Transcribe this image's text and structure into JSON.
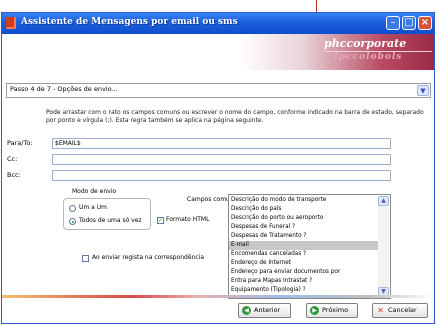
{
  "window": {
    "title": "Assistente de Mensagens por email ou sms",
    "brand_main": "phccorporate",
    "brand_sub": "fpccolobols"
  },
  "step": {
    "selected": "Passo 4 de 7 - Opções de envio..."
  },
  "info_text": "Pode arrastar com o rato os campos comuns ou escrever o nome do campo, conforme indicado na barra de estado, separado por ponto e vírgula (;). Esta regra também se aplica na página seguinte.",
  "fields": {
    "para_label": "Para/To:",
    "para_value": "$EMAIL$",
    "cc_label": "Cc:",
    "cc_value": "",
    "bcc_label": "Bcc:",
    "bcc_value": ""
  },
  "send_mode": {
    "label": "Modo de envio",
    "option_one": "Um a Um",
    "option_all": "Todos de uma só vez",
    "selected": "Todos de uma só vez",
    "html_format_label": "Formato HTML",
    "html_format_checked": true,
    "register_label": "Ao enviar regista na correspondência",
    "register_checked": false
  },
  "common_fields": {
    "label": "Campos comuns",
    "items": [
      "Descrição do modo de transporte",
      "Descrição do país",
      "Descrição do porto ou aeroporto",
      "Despesas de Funeral ?",
      "Despesas de Tratamento ?",
      "E-mail",
      "Encomendas canceladas ?",
      "Endereço de Internet",
      "Endereço para enviar documentos por",
      "Entra para Mapas Intrastat ?",
      "Equipamento (Tipologia) ?"
    ],
    "selected": "E-mail"
  },
  "footer": {
    "back_label": "Anterior",
    "next_label": "Próximo",
    "cancel_label": "Cancelar"
  }
}
